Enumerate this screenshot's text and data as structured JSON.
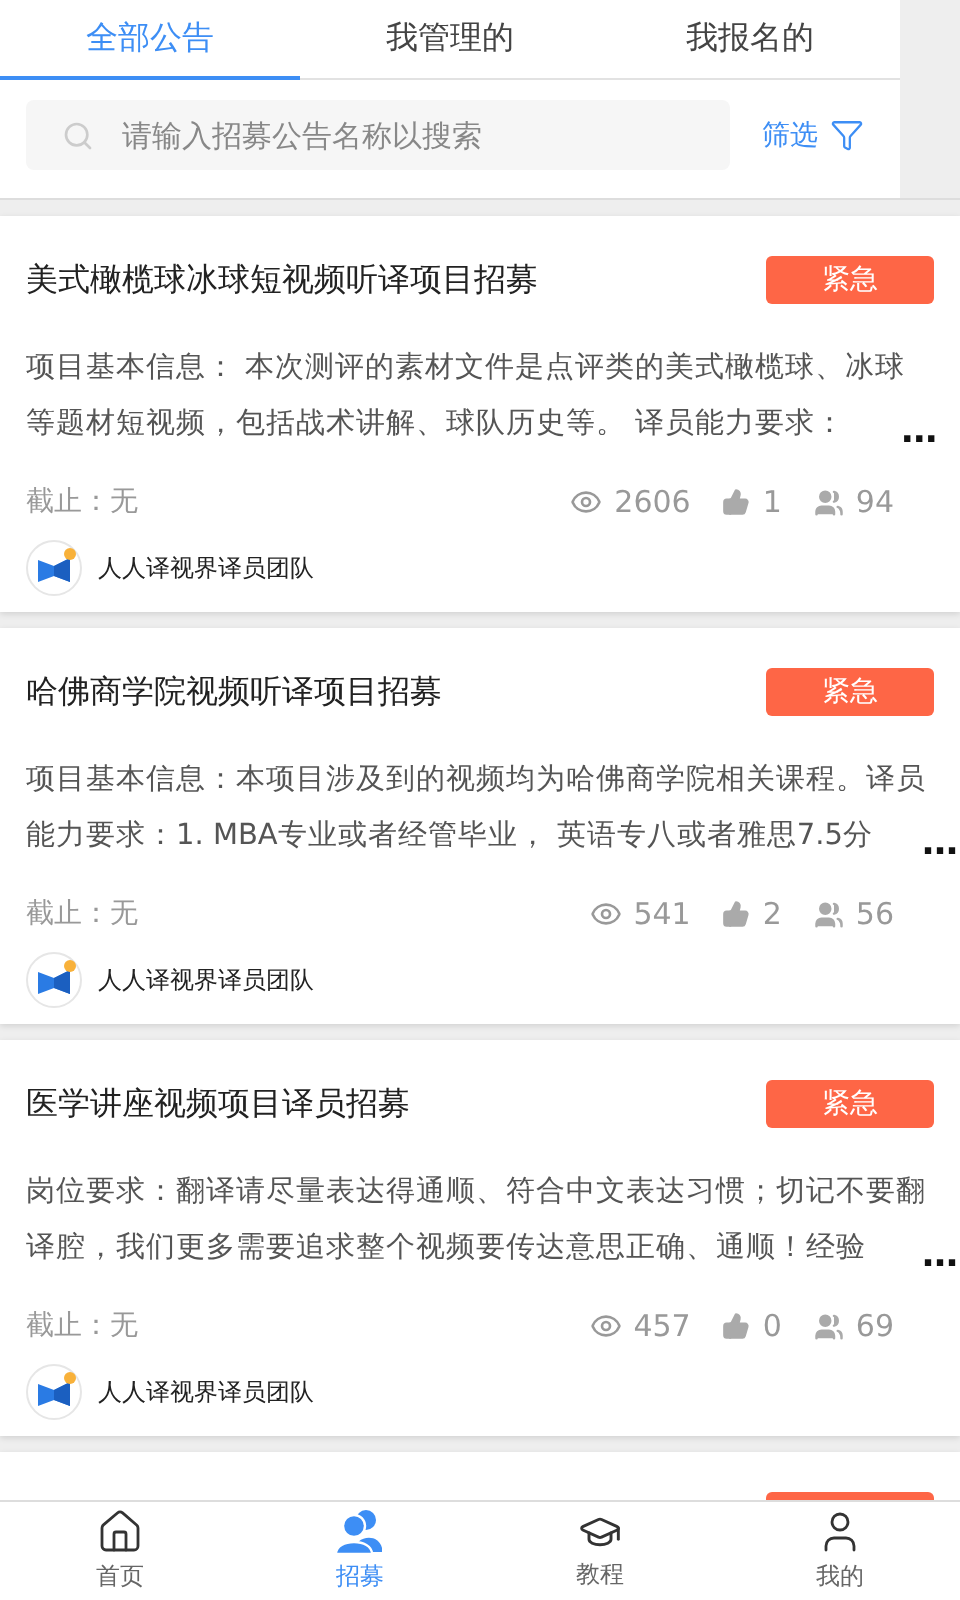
{
  "tabs": [
    {
      "label": "全部公告",
      "selected": true
    },
    {
      "label": "我管理的",
      "selected": false
    },
    {
      "label": "我报名的",
      "selected": false
    }
  ],
  "search": {
    "placeholder": "请输入招募公告名称以搜索"
  },
  "filter": {
    "label": "筛选"
  },
  "cards": [
    {
      "title": "美式橄榄球冰球短视频听译项目招募",
      "tag": "紧急",
      "description": [
        "项目基本信息： 本次测评的素材文件是点评类的美式橄榄球、冰球",
        "等题材短视频，包括战术讲解、球队历史等。 译员能力要求："
      ],
      "ellipsis": "…",
      "deadline": "截止：无",
      "views": "2606",
      "likes": "1",
      "members": "94",
      "team": "人人译视界译员团队"
    },
    {
      "title": "哈佛商学院视频听译项目招募",
      "tag": "紧急",
      "description": [
        "项目基本信息：本项目涉及到的视频均为哈佛商学院相关课程。译员",
        "能力要求：1. MBA专业或者经管毕业， 英语专八或者雅思7.5分"
      ],
      "ellipsis": "…",
      "deadline": "截止：无",
      "views": "541",
      "likes": "2",
      "members": "56",
      "team": "人人译视界译员团队"
    },
    {
      "title": "医学讲座视频项目译员招募",
      "tag": "紧急",
      "description": [
        "岗位要求：翻译请尽量表达得通顺、符合中文表达习惯；切记不要翻",
        "译腔，我们更多需要追求整个视频要传达意思正确、通顺！经验"
      ],
      "ellipsis": "…",
      "deadline": "截止：无",
      "views": "457",
      "likes": "0",
      "members": "69",
      "team": "人人译视界译员团队"
    }
  ],
  "nav": [
    {
      "label": "首页",
      "kind": "home",
      "selected": false
    },
    {
      "label": "招募",
      "kind": "people",
      "selected": true
    },
    {
      "label": "教程",
      "kind": "cap",
      "selected": false
    },
    {
      "label": "我的",
      "kind": "user",
      "selected": false
    }
  ]
}
